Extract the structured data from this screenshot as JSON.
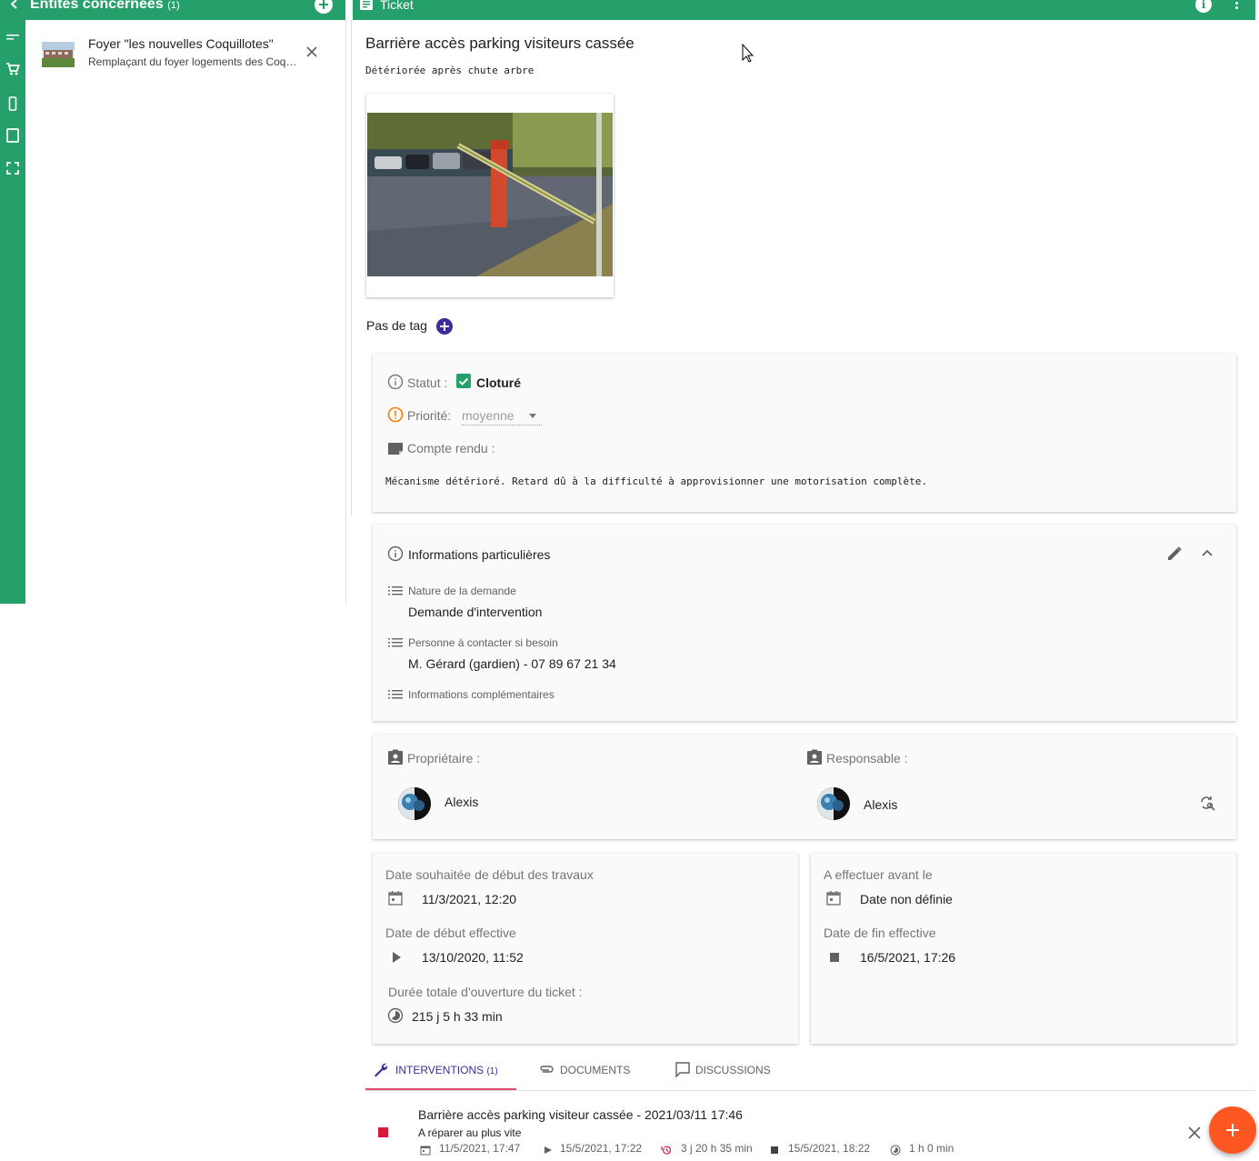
{
  "colors": {
    "primary": "#26a06a",
    "accent": "#3f2b96",
    "warning": "#f57c00",
    "fab": "#ff5722",
    "stopped": "#d81b3c"
  },
  "entities": {
    "title": "Entités concernées",
    "count": "(1)",
    "items": [
      {
        "name": "Foyer \"les nouvelles Coquillotes\"",
        "subtitle": "Remplaçant du foyer logements des Coquillotes"
      }
    ]
  },
  "ticket": {
    "header": "Ticket",
    "title": "Barrière accès parking visiteurs cassée",
    "description": "Détériorée après chute arbre",
    "tags_label": "Pas de tag",
    "status": {
      "label": "Statut :",
      "value": "Cloturé"
    },
    "priority": {
      "label": "Priorité:",
      "value": "moyenne"
    },
    "report": {
      "label": "Compte rendu :",
      "text": "Mécanisme détérioré. Retard dû à la difficulté à approvisionner une motorisation complète."
    },
    "info": {
      "title": "Informations particulières",
      "fields": [
        {
          "label": "Nature de la demande",
          "value": "Demande d'intervention"
        },
        {
          "label": "Personne à contacter si besoin",
          "value": "M. Gérard (gardien) - 07 89 67 21 34"
        },
        {
          "label": "Informations complémentaires",
          "value": ""
        }
      ]
    },
    "owner": {
      "label": "Propriétaire :",
      "name": "Alexis"
    },
    "responsible": {
      "label": "Responsable :",
      "name": "Alexis"
    },
    "dates": {
      "wished_start_label": "Date souhaitée de début des travaux",
      "wished_start": "11/3/2021, 12:20",
      "effective_start_label": "Date de début effective",
      "effective_start": "13/10/2020, 11:52",
      "duration_label": "Durée totale d'ouverture du ticket :",
      "duration": "215 j 5 h 33 min",
      "due_label": "A effectuer avant le",
      "due": "Date non définie",
      "effective_end_label": "Date de fin effective",
      "effective_end": "16/5/2021, 17:26"
    }
  },
  "tabs": [
    {
      "label": "INTERVENTIONS",
      "count": "(1)",
      "icon": "wrench-icon"
    },
    {
      "label": "DOCUMENTS",
      "icon": "paperclip-icon"
    },
    {
      "label": "DISCUSSIONS",
      "icon": "chat-icon"
    }
  ],
  "intervention": {
    "title": "Barrière accès parking visiteur cassée - 2021/03/11 17:46",
    "subtitle": "A réparer au plus vite",
    "planned": "11/5/2021, 17:47",
    "started": "15/5/2021, 17:22",
    "delay": "3 j  20 h  35 min",
    "ended": "15/5/2021, 18:22",
    "duration": "1 h  0 min"
  }
}
